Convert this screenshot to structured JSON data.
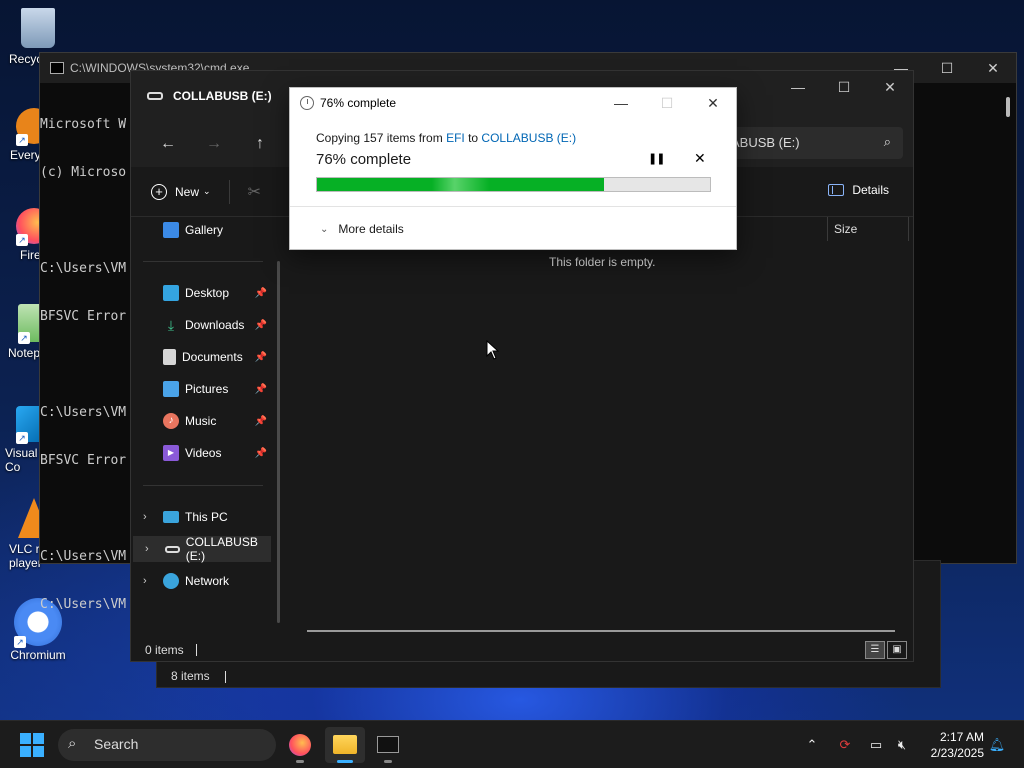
{
  "desktop": {
    "icons": [
      {
        "label": "Recyc"
      },
      {
        "label": "Every"
      },
      {
        "label": "Fire"
      },
      {
        "label": "Notep"
      },
      {
        "label": "Visual\nCo"
      },
      {
        "label": "VLC r\nplayer"
      },
      {
        "label": "Chromium"
      }
    ]
  },
  "cmd": {
    "title": "C:\\WINDOWS\\system32\\cmd.exe",
    "lines": [
      "Microsoft W",
      "(c) Microso",
      "",
      "C:\\Users\\VM",
      "BFSVC Error",
      "",
      "C:\\Users\\VM",
      "BFSVC Error",
      "",
      "C:\\Users\\VM",
      "C:\\Users\\VM"
    ],
    "controls": {
      "min": "—",
      "max": "☐",
      "close": "✕"
    }
  },
  "explorer_back": {
    "status": "8 items"
  },
  "explorer": {
    "title": "COLLABUSB (E:)",
    "controls": {
      "min": "—",
      "max": "☐",
      "close": "✕"
    },
    "nav": {
      "back": "←",
      "forward": "→",
      "up": "↑"
    },
    "search_text": "ABUSB (E:)",
    "toolbar": {
      "new_label": "New",
      "details_label": "Details"
    },
    "sidebar": {
      "gallery": "Gallery",
      "quick": [
        {
          "label": "Desktop"
        },
        {
          "label": "Downloads"
        },
        {
          "label": "Documents"
        },
        {
          "label": "Pictures"
        },
        {
          "label": "Music"
        },
        {
          "label": "Videos"
        }
      ],
      "this_pc": "This PC",
      "usb": "COLLABUSB (E:)",
      "network": "Network"
    },
    "columns": {
      "size": "Size"
    },
    "empty_text": "This folder is empty.",
    "status": "0 items"
  },
  "dialog": {
    "title": "76% complete",
    "copy_prefix": "Copying 157 items from ",
    "source": "EFI",
    "copy_mid": " to ",
    "destination": "COLLABUSB (E:)",
    "percent_text": "76% complete",
    "progress": 0.73,
    "more_details": "More details",
    "controls": {
      "min": "—",
      "max": "☐",
      "close": "✕"
    }
  },
  "taskbar": {
    "search_label": "Search",
    "time": "2:17 AM",
    "date": "2/23/2025"
  },
  "colors": {
    "accent": "#3ab0ff",
    "progress_fill": "#06b025",
    "link": "#0066b4"
  }
}
